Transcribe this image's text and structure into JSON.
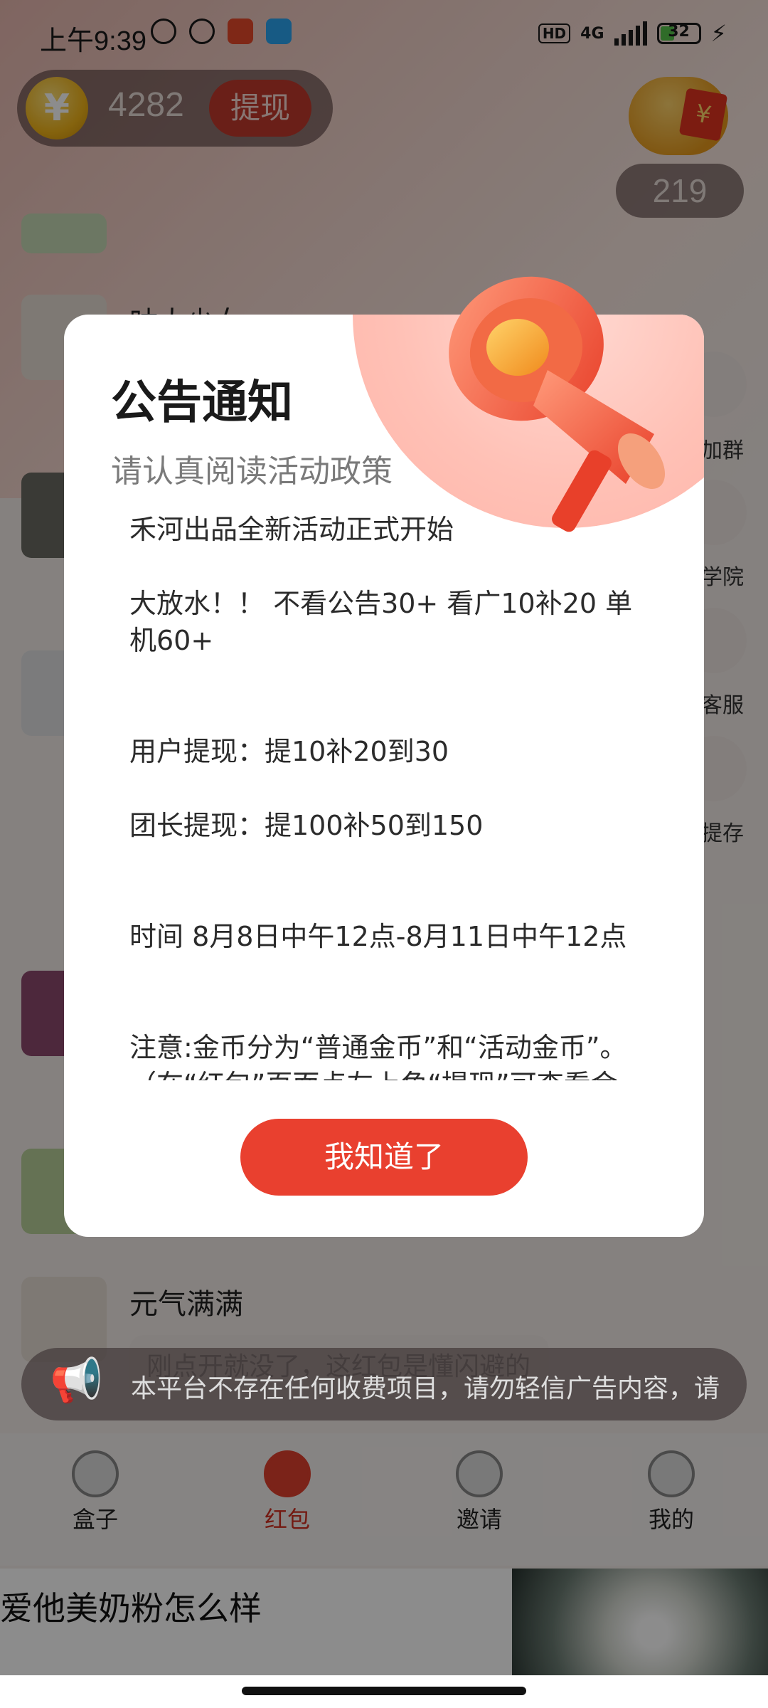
{
  "status_bar": {
    "time": "上午9:39",
    "hd": "HD",
    "network": "4G",
    "battery": "32"
  },
  "header": {
    "coin_symbol": "¥",
    "coin_balance": "4282",
    "withdraw_label": "提现",
    "piggy_symbol": "¥",
    "piggy_count": "219"
  },
  "list": {
    "items": [
      {
        "title": "咕大少女"
      },
      {
        "title": "元气满满",
        "preview": "刚点开就没了，这红包是懂闪避的"
      }
    ]
  },
  "side_menu": {
    "items": [
      {
        "label": "加群"
      },
      {
        "label": "学院"
      },
      {
        "label": "客服"
      },
      {
        "label": "提存"
      }
    ]
  },
  "notice_bar": {
    "text": "本平台不存在任何收费项目，请勿轻信广告内容，请"
  },
  "bottom_nav": {
    "items": [
      {
        "label": "盒子"
      },
      {
        "label": "红包"
      },
      {
        "label": "邀请"
      },
      {
        "label": "我的"
      }
    ]
  },
  "ad": {
    "text": "爱他美奶粉怎么样"
  },
  "dialog": {
    "title": "公告通知",
    "subtitle": "请认真阅读活动政策",
    "body": [
      "禾河出品全新活动正式开始",
      "大放水！！ 不看公告30+ 看广10补20 单机60+",
      "用户提现：提10补20到30",
      "团长提现：提100补50到150",
      "时间 8月8日中午12点-8月11日中午12点",
      "注意:金币分为“普通金币”和“活动金币”。（在“红包”页面点左上角“提现”可查看金"
    ],
    "confirm_label": "我知道了"
  },
  "colors": {
    "accent": "#e9402f",
    "coin": "#f2b51a",
    "active_nav": "#d12e1f"
  }
}
